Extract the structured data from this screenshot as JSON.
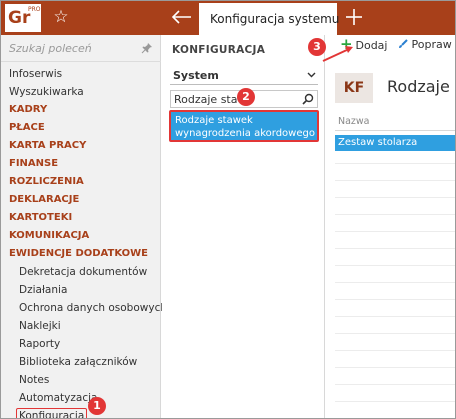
{
  "topbar": {
    "logo_text": "Gr",
    "logo_badge": "PRO",
    "active_tab": "Konfiguracja systemu"
  },
  "sidebar": {
    "search_placeholder": "Szukaj poleceń",
    "items": [
      {
        "label": "Infoserwis",
        "kind": "plain"
      },
      {
        "label": "Wyszukiwarka",
        "kind": "plain"
      },
      {
        "label": "KADRY",
        "kind": "category"
      },
      {
        "label": "PŁACE",
        "kind": "category"
      },
      {
        "label": "KARTA PRACY",
        "kind": "category"
      },
      {
        "label": "FINANSE",
        "kind": "category"
      },
      {
        "label": "ROZLICZENIA",
        "kind": "category"
      },
      {
        "label": "DEKLARACJE",
        "kind": "category"
      },
      {
        "label": "KARTOTEKI",
        "kind": "category"
      },
      {
        "label": "KOMUNIKACJA",
        "kind": "category"
      },
      {
        "label": "EWIDENCJE DODATKOWE",
        "kind": "category"
      },
      {
        "label": "Dekretacja dokumentów",
        "kind": "sub"
      },
      {
        "label": "Działania",
        "kind": "sub"
      },
      {
        "label": "Ochrona danych osobowych",
        "kind": "sub"
      },
      {
        "label": "Naklejki",
        "kind": "sub"
      },
      {
        "label": "Raporty",
        "kind": "sub"
      },
      {
        "label": "Biblioteka załączników",
        "kind": "sub"
      },
      {
        "label": "Notes",
        "kind": "sub"
      },
      {
        "label": "Automatyzacja",
        "kind": "sub"
      },
      {
        "label": "Konfiguracja",
        "kind": "sub-highlight"
      }
    ]
  },
  "middle": {
    "title": "KONFIGURACJA",
    "select_value": "System",
    "search_value": "Rodzaje staw",
    "result_label": "Rodzaje stawek wynagrodzenia akordowego"
  },
  "right": {
    "toolbar": {
      "add_label": "Dodaj",
      "edit_label": "Popraw"
    },
    "badge": "KF",
    "page_title": "Rodzaje s",
    "grid": {
      "column": "Nazwa",
      "rows": [
        "Zestaw stolarza"
      ]
    }
  },
  "callouts": {
    "one": "1",
    "two": "2",
    "three": "3"
  },
  "colors": {
    "brand": "#a8401a",
    "selection": "#2f9fe0",
    "callout": "#e23636",
    "add_green": "#2ba640"
  },
  "icons": [
    "star-icon",
    "back-arrow-icon",
    "plus-tab-icon",
    "pin-icon",
    "chevron-down-icon",
    "search-icon",
    "plus-icon",
    "brush-icon"
  ]
}
